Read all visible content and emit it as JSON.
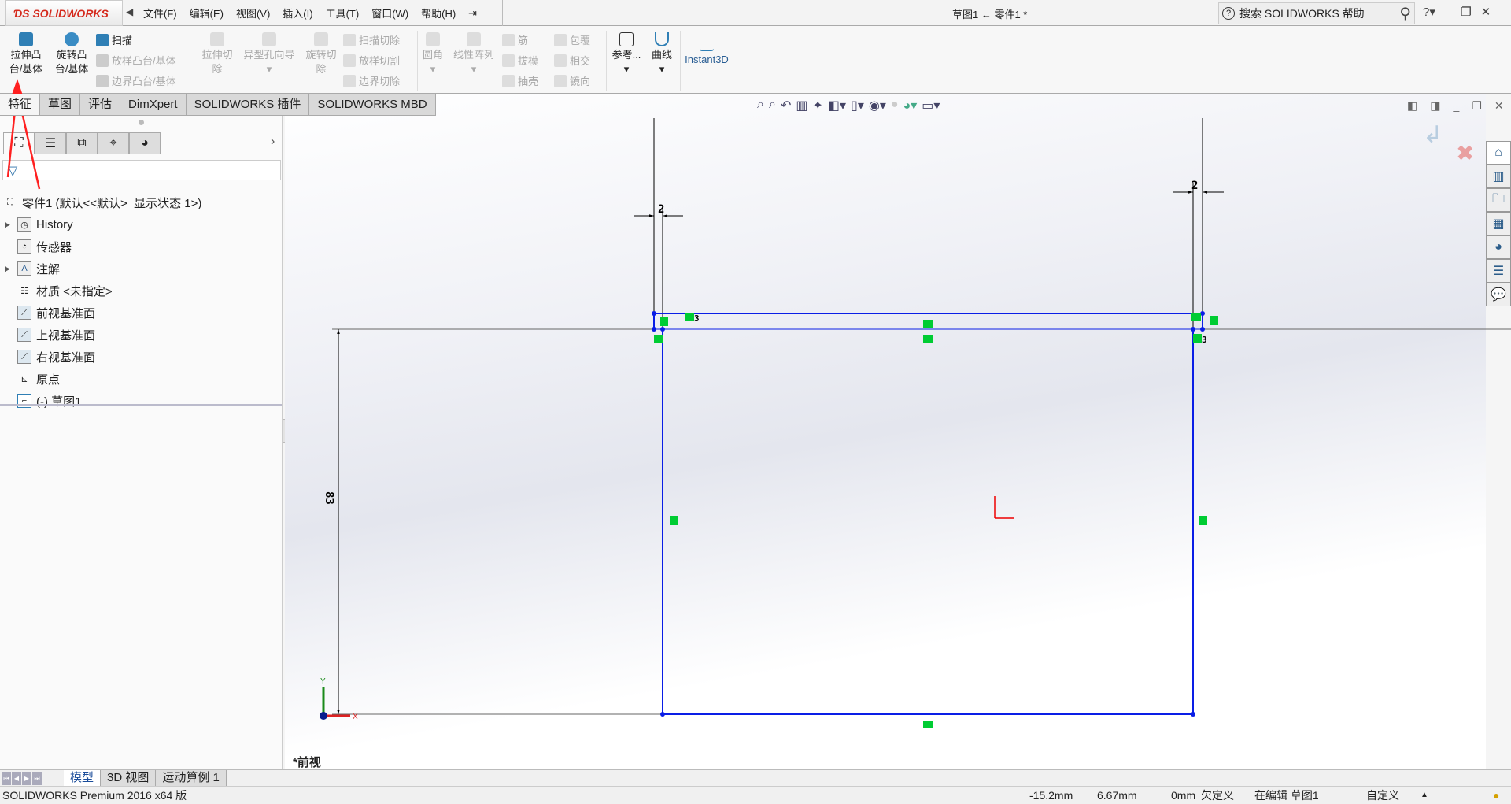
{
  "app": {
    "logo_text": "SOLIDWORKS",
    "document_title": "草图1 ← 零件1 *"
  },
  "menu": [
    "文件(F)",
    "编辑(E)",
    "视图(V)",
    "插入(I)",
    "工具(T)",
    "窗口(W)",
    "帮助(H)"
  ],
  "search": {
    "placeholder": "搜索 SOLIDWORKS 帮助"
  },
  "ribbon": {
    "extrude_boss": "拉伸凸\n台/基体",
    "extrude_boss_l1": "拉伸凸",
    "extrude_boss_l2": "台/基体",
    "revolve_boss_l1": "旋转凸",
    "revolve_boss_l2": "台/基体",
    "sweep": "扫描",
    "loft": "放样凸台/基体",
    "boundary": "边界凸台/基体",
    "extrude_cut_l1": "拉伸切",
    "extrude_cut_l2": "除",
    "hole_wizard": "异型孔向导",
    "revolve_cut_l1": "旋转切",
    "revolve_cut_l2": "除",
    "swept_cut": "扫描切除",
    "lofted_cut": "放样切割",
    "boundary_cut": "边界切除",
    "fillet": "圆角",
    "linear_pattern": "线性阵列",
    "rib": "筋",
    "draft": "拔模",
    "shell": "抽壳",
    "wrap": "包覆",
    "intersect": "相交",
    "mirror": "镜向",
    "reference": "参考...",
    "curves": "曲线",
    "instant3d": "Instant3D"
  },
  "command_tabs": [
    "特征",
    "草图",
    "评估",
    "DimXpert",
    "SOLIDWORKS 插件",
    "SOLIDWORKS MBD"
  ],
  "feature_tree": {
    "root": "零件1  (默认<<默认>_显示状态 1>)",
    "items": [
      {
        "label": "History",
        "expandable": true,
        "icon": "history-folder-icon"
      },
      {
        "label": "传感器",
        "expandable": false,
        "icon": "sensor-folder-icon"
      },
      {
        "label": "注解",
        "expandable": true,
        "icon": "annotation-folder-icon"
      },
      {
        "label": "材质 <未指定>",
        "expandable": false,
        "icon": "material-icon"
      },
      {
        "label": "前视基准面",
        "expandable": false,
        "icon": "plane-icon"
      },
      {
        "label": "上视基准面",
        "expandable": false,
        "icon": "plane-icon"
      },
      {
        "label": "右视基准面",
        "expandable": false,
        "icon": "plane-icon"
      },
      {
        "label": "原点",
        "expandable": false,
        "icon": "origin-icon"
      },
      {
        "label": "(-) 草图1",
        "expandable": false,
        "icon": "sketch-icon"
      }
    ]
  },
  "sketch": {
    "dimensions": {
      "height": "83",
      "left_thickness": "2",
      "right_thickness": "2"
    },
    "relation_counts": {
      "top_left": "3",
      "right": "3"
    },
    "axis_x": "X",
    "axis_y": "Y",
    "colors": {
      "sketch_line": "#0a1ee6",
      "relation": "#00cc33",
      "annotation_arrow": "#ff2020"
    }
  },
  "view_label": "*前视",
  "bottom_tabs": [
    "模型",
    "3D 视图",
    "运动算例 1"
  ],
  "status": {
    "product": "SOLIDWORKS Premium 2016 x64 版",
    "x": "-15.2mm",
    "y": "6.67mm",
    "z": "0mm",
    "state": "欠定义",
    "editing": "在编辑 草图1",
    "units": "自定义"
  }
}
